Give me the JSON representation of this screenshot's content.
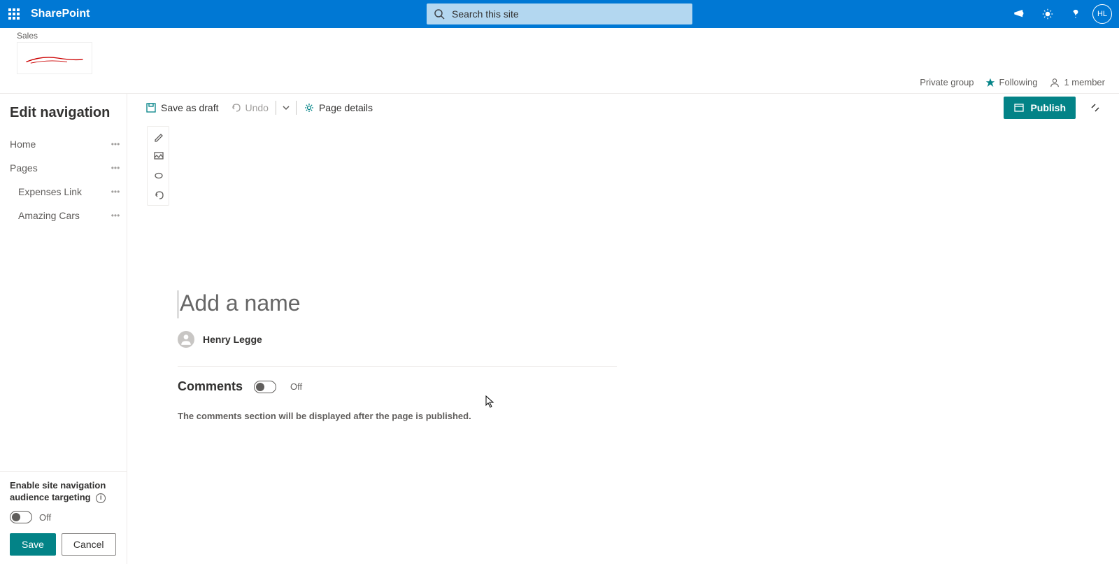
{
  "suite": {
    "product": "SharePoint",
    "search_placeholder": "Search this site",
    "avatar_initials": "HL"
  },
  "site": {
    "name": "Sales",
    "group_type": "Private group",
    "following_label": "Following",
    "members_label": "1 member"
  },
  "commandbar": {
    "save_draft": "Save as draft",
    "undo": "Undo",
    "page_details": "Page details",
    "publish": "Publish"
  },
  "leftnav": {
    "title": "Edit navigation",
    "items": [
      {
        "label": "Home",
        "indent": false
      },
      {
        "label": "Pages",
        "indent": false
      },
      {
        "label": "Expenses Link",
        "indent": true
      },
      {
        "label": "Amazing Cars",
        "indent": true
      }
    ],
    "audience_label_line1": "Enable site navigation",
    "audience_label_line2": "audience targeting",
    "audience_toggle_state": "Off",
    "save": "Save",
    "cancel": "Cancel"
  },
  "page": {
    "title_placeholder": "Add a name",
    "author": "Henry Legge",
    "comments_title": "Comments",
    "comments_toggle_state": "Off",
    "comments_note": "The comments section will be displayed after the page is published."
  }
}
